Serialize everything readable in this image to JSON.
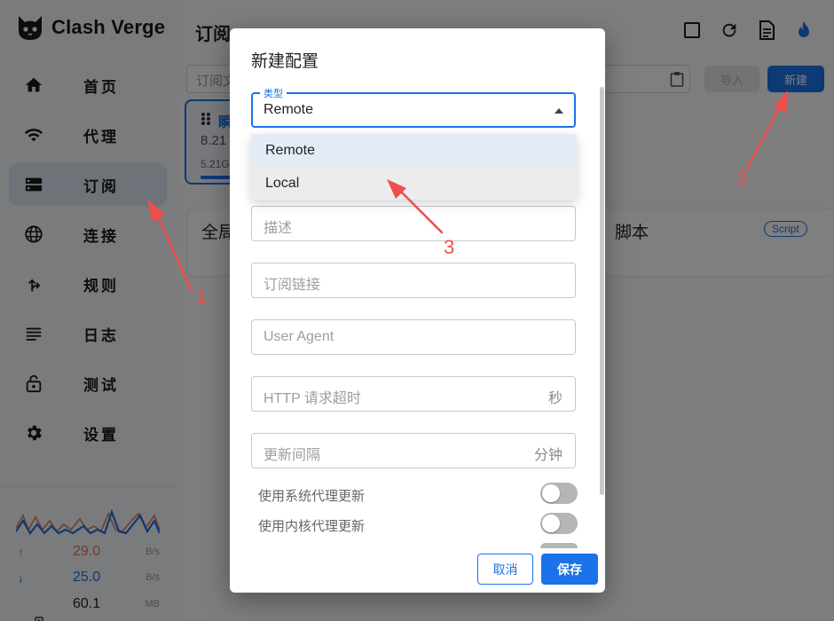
{
  "app": {
    "name": "Clash Verge"
  },
  "sidebar": {
    "items": [
      {
        "label": "首页",
        "icon": "home-icon"
      },
      {
        "label": "代理",
        "icon": "wifi-icon"
      },
      {
        "label": "订阅",
        "icon": "storage-icon",
        "active": true
      },
      {
        "label": "连接",
        "icon": "globe-icon"
      },
      {
        "label": "规则",
        "icon": "fork-icon"
      },
      {
        "label": "日志",
        "icon": "list-icon"
      },
      {
        "label": "测试",
        "icon": "lock-icon"
      },
      {
        "label": "设置",
        "icon": "gear-icon"
      }
    ],
    "traffic": {
      "upload": {
        "value": "29.0",
        "unit": "B/s",
        "color": "#e07a5f"
      },
      "download": {
        "value": "25.0",
        "unit": "B/s",
        "color": "#1a73e8"
      },
      "memory": {
        "value": "60.1",
        "unit": "MB"
      }
    }
  },
  "header": {
    "title": "订阅"
  },
  "toolbar": {
    "subscription_placeholder": "订阅文",
    "import_label": "导入",
    "new_label": "新建",
    "icons": [
      "square-icon",
      "refresh-icon",
      "document-icon",
      "flame-icon"
    ]
  },
  "profile_card": {
    "name": "瞬",
    "updated": "8.21",
    "size": "5.21G",
    "usage_fraction": 0.15
  },
  "global_card": {
    "left_text": "全局",
    "right_text": "脚本",
    "badge": "Script"
  },
  "dialog": {
    "title": "新建配置",
    "type_label": "类型",
    "type_value": "Remote",
    "type_options": [
      "Remote",
      "Local"
    ],
    "description_placeholder": "描述",
    "url_placeholder": "订阅链接",
    "user_agent_placeholder": "User Agent",
    "timeout_placeholder": "HTTP 请求超时",
    "timeout_unit": "秒",
    "interval_placeholder": "更新间隔",
    "interval_unit": "分钟",
    "toggle_system_proxy": "使用系统代理更新",
    "toggle_core_proxy": "使用内核代理更新",
    "cancel_label": "取消",
    "save_label": "保存"
  },
  "annotations": {
    "step1": "1",
    "step2": "2",
    "step3": "3",
    "color": "#f04d4d"
  }
}
